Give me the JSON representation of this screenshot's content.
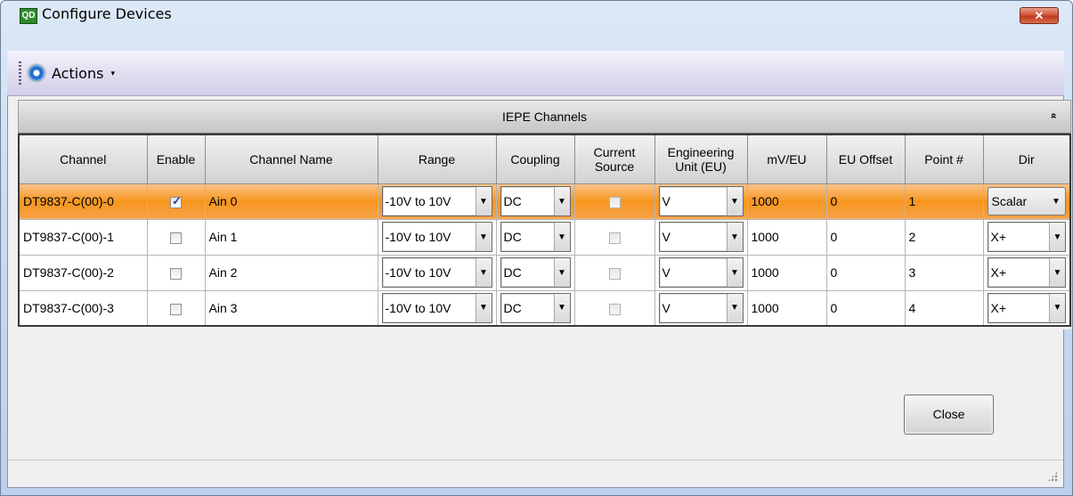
{
  "window": {
    "title": "Configure Devices",
    "icon_text": "QD",
    "close_glyph": "✕"
  },
  "toolbar": {
    "actions_label": "Actions",
    "caret": "▾"
  },
  "group": {
    "title": "IEPE Channels",
    "collapse_glyph": "»"
  },
  "columns": [
    "Channel",
    "Enable",
    "Channel Name",
    "Range",
    "Coupling",
    "Current Source",
    "Engineering Unit (EU)",
    "mV/EU",
    "EU Offset",
    "Point #",
    "Dir"
  ],
  "rows": [
    {
      "channel": "DT9837-C(00)-0",
      "enabled": true,
      "name": "Ain 0",
      "range": "-10V to 10V",
      "coupling": "DC",
      "current_source": false,
      "eu": "V",
      "mv_eu": "1000",
      "eu_offset": "0",
      "point": "1",
      "dir": "Scalar"
    },
    {
      "channel": "DT9837-C(00)-1",
      "enabled": false,
      "name": "Ain 1",
      "range": "-10V to 10V",
      "coupling": "DC",
      "current_source": false,
      "eu": "V",
      "mv_eu": "1000",
      "eu_offset": "0",
      "point": "2",
      "dir": "X+"
    },
    {
      "channel": "DT9837-C(00)-2",
      "enabled": false,
      "name": "Ain 2",
      "range": "-10V to 10V",
      "coupling": "DC",
      "current_source": false,
      "eu": "V",
      "mv_eu": "1000",
      "eu_offset": "0",
      "point": "3",
      "dir": "X+"
    },
    {
      "channel": "DT9837-C(00)-3",
      "enabled": false,
      "name": "Ain 3",
      "range": "-10V to 10V",
      "coupling": "DC",
      "current_source": false,
      "eu": "V",
      "mv_eu": "1000",
      "eu_offset": "0",
      "point": "4",
      "dir": "X+"
    }
  ],
  "selected_row": 0,
  "buttons": {
    "close": "Close"
  },
  "colors": {
    "selection": "#f7961e",
    "titlebar": "#c8daf1",
    "toolbar": "#e4e0f2"
  }
}
